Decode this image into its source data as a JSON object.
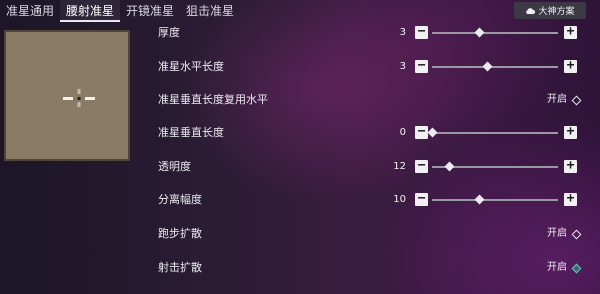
{
  "tabs": [
    {
      "label": "准星通用",
      "active": false
    },
    {
      "label": "腰射准星",
      "active": true
    },
    {
      "label": "开镜准星",
      "active": false
    },
    {
      "label": "狙击准星",
      "active": false
    }
  ],
  "scheme_button": {
    "label": "大神方案"
  },
  "settings": [
    {
      "label": "厚度",
      "type": "slider",
      "value": "3",
      "fraction": 0.38
    },
    {
      "label": "准星水平长度",
      "type": "slider",
      "value": "3",
      "fraction": 0.44
    },
    {
      "label": "准星垂直长度复用水平",
      "type": "toggle",
      "state": "开启"
    },
    {
      "label": "准星垂直长度",
      "type": "slider",
      "value": "0",
      "fraction": 0.0
    },
    {
      "label": "透明度",
      "type": "slider",
      "value": "12",
      "fraction": 0.14
    },
    {
      "label": "分离幅度",
      "type": "slider",
      "value": "10",
      "fraction": 0.38
    },
    {
      "label": "跑步扩散",
      "type": "toggle",
      "state": "开启"
    },
    {
      "label": "射击扩散",
      "type": "toggle",
      "state": "开启"
    }
  ],
  "controls": {
    "minus": "−",
    "plus": "+"
  },
  "colors": {
    "toggle_on_accent": "#4fd6b0",
    "preview_bg": "#8a7b66"
  }
}
